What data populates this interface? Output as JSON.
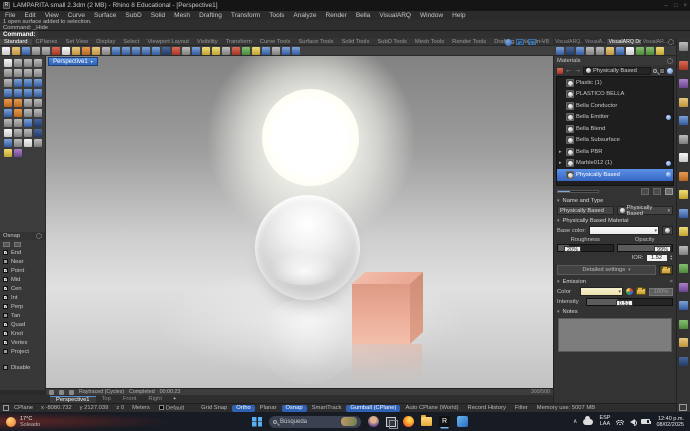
{
  "window": {
    "title": "LAMPARITA small 2.3dm (2 MB) - Rhino 8 Educational - [Perspective1]",
    "controls": {
      "minimize": "–",
      "maximize": "□",
      "close": "×"
    }
  },
  "menu": [
    {
      "label": "File"
    },
    {
      "label": "Edit"
    },
    {
      "label": "View"
    },
    {
      "label": "Curve"
    },
    {
      "label": "Surface"
    },
    {
      "label": "SubD"
    },
    {
      "label": "Solid"
    },
    {
      "label": "Mesh"
    },
    {
      "label": "Drafting"
    },
    {
      "label": "Transform"
    },
    {
      "label": "Tools"
    },
    {
      "label": "Analyze"
    },
    {
      "label": "Render"
    },
    {
      "label": "Bella"
    },
    {
      "label": "VisualARQ"
    },
    {
      "label": "Window"
    },
    {
      "label": "Help"
    }
  ],
  "command": {
    "history_line1": "1 open surface added to selection.",
    "history_line2": "Command: _Hide",
    "prompt": "Command:"
  },
  "toolbar_tabs": [
    {
      "label": "Standard",
      "state": "active"
    },
    {
      "label": "CPlanes"
    },
    {
      "label": "Set View"
    },
    {
      "label": "Display"
    },
    {
      "label": "Select"
    },
    {
      "label": "Viewport Layout"
    },
    {
      "label": "Visibility"
    },
    {
      "label": "Transform"
    },
    {
      "label": "Curve Tools"
    },
    {
      "label": "Surface Tools"
    },
    {
      "label": "Solid Tools"
    },
    {
      "label": "SubD Tools"
    },
    {
      "label": "Mesh Tools"
    },
    {
      "label": "Render Tools"
    },
    {
      "label": "Drafting"
    },
    {
      "label": "New in V8"
    }
  ],
  "quick_icons": [
    {
      "n": "render-sphere-icon"
    },
    {
      "n": "ipr-start-icon"
    },
    {
      "n": "ipr-window-icon"
    }
  ],
  "main_icons": [
    {
      "n": "new-file-icon",
      "c": "i0"
    },
    {
      "n": "open-file-icon",
      "c": "i1"
    },
    {
      "n": "save-icon",
      "c": "i2"
    },
    {
      "n": "print-icon",
      "c": "i9"
    },
    {
      "n": "cut-icon",
      "c": "i9"
    },
    {
      "n": "delete-icon",
      "c": "i5"
    },
    {
      "n": "copy-icon",
      "c": "i0"
    },
    {
      "n": "paste-icon",
      "c": "i1"
    },
    {
      "n": "undo-icon",
      "c": "i4"
    },
    {
      "n": "pan-icon",
      "c": "i1"
    },
    {
      "n": "move-view-icon",
      "c": "i9"
    },
    {
      "n": "zoom-icon",
      "c": "i2"
    },
    {
      "n": "zoom-window-icon",
      "c": "i2"
    },
    {
      "n": "zoom-extents-icon",
      "c": "i2"
    },
    {
      "n": "zoom-selected-icon",
      "c": "i2"
    },
    {
      "n": "rotate-view-icon",
      "c": "i2"
    },
    {
      "n": "layers-icon",
      "c": "i3"
    },
    {
      "n": "hide-icon",
      "c": "i5"
    },
    {
      "n": "show-icon",
      "c": "i9"
    },
    {
      "n": "select-icon",
      "c": "i2"
    },
    {
      "n": "lasso-icon",
      "c": "i7"
    },
    {
      "n": "light-icon",
      "c": "i7"
    },
    {
      "n": "move-icon",
      "c": "i9"
    },
    {
      "n": "render-icon",
      "c": "i5"
    },
    {
      "n": "render-preview-icon",
      "c": "i6"
    },
    {
      "n": "sun-icon",
      "c": "i7"
    },
    {
      "n": "material-icon",
      "c": "i2"
    },
    {
      "n": "options-icon",
      "c": "i9"
    },
    {
      "n": "gumball-icon",
      "c": "i2"
    },
    {
      "n": "help-icon",
      "c": "i2"
    }
  ],
  "panel_tabs": [
    {
      "label": "VisualARQ.."
    },
    {
      "label": "VisualA..."
    },
    {
      "label": "VisualARQ Doc...",
      "state": "active"
    },
    {
      "label": "VisualAR..."
    }
  ],
  "va_icons": [
    {
      "n": "va-select-icon",
      "c": "i2"
    },
    {
      "n": "va-orbit-icon",
      "c": "i3"
    },
    {
      "n": "va-wall-icon",
      "c": "i2"
    },
    {
      "n": "va-dots-icon",
      "c": "i9"
    },
    {
      "n": "va-beam-icon",
      "c": "i9"
    },
    {
      "n": "va-door-icon",
      "c": "i1"
    },
    {
      "n": "va-window-icon",
      "c": "i2"
    },
    {
      "n": "va-house-icon",
      "c": "i0"
    },
    {
      "n": "va-globe-icon",
      "c": "i6"
    },
    {
      "n": "va-globe2-icon",
      "c": "i6"
    },
    {
      "n": "va-table-icon",
      "c": "i7"
    }
  ],
  "left_icons": [
    {
      "n": "pointer-tool-icon",
      "c": "i0"
    },
    {
      "n": "select-tool-icon",
      "c": "i9"
    },
    {
      "n": "line-tool-icon",
      "c": "i9"
    },
    {
      "n": "curve-tool-icon",
      "c": "i9"
    },
    {
      "n": "point-tool-icon",
      "c": "i9"
    },
    {
      "n": "circle-tool-icon",
      "c": "i9"
    },
    {
      "n": "arc-tool-icon",
      "c": "i9"
    },
    {
      "n": "rectangle-tool-icon",
      "c": "i9"
    },
    {
      "n": "polygon-tool-icon",
      "c": "i9"
    },
    {
      "n": "surface-tool-icon",
      "c": "i2"
    },
    {
      "n": "loft-tool-icon",
      "c": "i2"
    },
    {
      "n": "sweep-tool-icon",
      "c": "i2"
    },
    {
      "n": "box-tool-icon",
      "c": "i2"
    },
    {
      "n": "sphere-tool-icon",
      "c": "i2"
    },
    {
      "n": "cylinder-tool-icon",
      "c": "i2"
    },
    {
      "n": "pipe-tool-icon",
      "c": "i2"
    },
    {
      "n": "fillet-tool-icon",
      "c": "i4"
    },
    {
      "n": "chamfer-tool-icon",
      "c": "i4"
    },
    {
      "n": "trim-tool-icon",
      "c": "i9"
    },
    {
      "n": "split-tool-icon",
      "c": "i9"
    },
    {
      "n": "join-tool-icon",
      "c": "i2"
    },
    {
      "n": "explode-tool-icon",
      "c": "i4"
    },
    {
      "n": "move-tool-icon",
      "c": "i9"
    },
    {
      "n": "copy-tool-icon",
      "c": "i9"
    },
    {
      "n": "rotate-tool-icon",
      "c": "i9"
    },
    {
      "n": "scale-tool-icon",
      "c": "i9"
    },
    {
      "n": "mirror-tool-icon",
      "c": "i2"
    },
    {
      "n": "array-tool-icon",
      "c": "i3"
    },
    {
      "n": "text-tool-icon",
      "c": "i0"
    },
    {
      "n": "dimension-tool-icon",
      "c": "i9"
    },
    {
      "n": "leader-tool-icon",
      "c": "i9"
    },
    {
      "n": "hatch-tool-icon",
      "c": "i3"
    },
    {
      "n": "block-tool-icon",
      "c": "i2"
    },
    {
      "n": "group-tool-icon",
      "c": "i9"
    },
    {
      "n": "check-tool-icon",
      "c": "i0"
    },
    {
      "n": "measure-tool-icon",
      "c": "i9"
    },
    {
      "n": "lamp-tool-icon",
      "c": "i7"
    },
    {
      "n": "material-tool-icon",
      "c": "i8"
    }
  ],
  "osnap": {
    "title": "Osnap",
    "items": [
      {
        "label": "End",
        "state": "on"
      },
      {
        "label": "Near",
        "state": "off"
      },
      {
        "label": "Point",
        "state": "on"
      },
      {
        "label": "Mid",
        "state": "on"
      },
      {
        "label": "Cen",
        "state": "on"
      },
      {
        "label": "Int",
        "state": "on"
      },
      {
        "label": "Perp",
        "state": "on"
      },
      {
        "label": "Tan",
        "state": "off"
      },
      {
        "label": "Quad",
        "state": "on"
      },
      {
        "label": "Knot",
        "state": "on"
      },
      {
        "label": "Vertex",
        "state": "on"
      },
      {
        "label": "Project",
        "state": "off"
      }
    ],
    "disable_label": "Disable"
  },
  "viewport": {
    "active_view": "Perspective1",
    "render_mode": "Raytraced (Cycles)",
    "render_status": "Completed",
    "render_time": "00:00:23",
    "render_samples": "300/500"
  },
  "viewport_tabs": {
    "tabs": [
      {
        "label": "Perspective1",
        "state": "active"
      },
      {
        "label": "Top"
      },
      {
        "label": "Front"
      },
      {
        "label": "Right"
      }
    ],
    "new_tab": "+"
  },
  "status": {
    "left": [
      {
        "label": "CPlane"
      },
      {
        "label": "x -8080.732"
      },
      {
        "label": "y 2127.039"
      },
      {
        "label": "z 0"
      },
      {
        "label": "Meters"
      }
    ],
    "layer_label": "Default",
    "toggles": [
      {
        "label": "Grid Snap"
      },
      {
        "label": "Ortho",
        "state": "active"
      },
      {
        "label": "Planar"
      },
      {
        "label": "Osnap",
        "state": "active"
      },
      {
        "label": "SmartTrack"
      },
      {
        "label": "Gumball (CPlane)",
        "state": "active"
      },
      {
        "label": "Auto CPlane (World)"
      },
      {
        "label": "Record History"
      },
      {
        "label": "Filter"
      }
    ],
    "memory": "Memory use: 5007 MB"
  },
  "materials": {
    "panel_title": "Materials",
    "search_value": "Physically Based",
    "list": [
      {
        "name": "Plastic (1)"
      },
      {
        "name": "PLASTICO BELLA"
      },
      {
        "name": "Bella Conductor"
      },
      {
        "name": "Bella Emitter",
        "dot": "show"
      },
      {
        "name": "Bella Blend"
      },
      {
        "name": "Bella Subsurface"
      },
      {
        "name": "Bella PBR",
        "exp": "show"
      },
      {
        "name": "Marble012 (1)",
        "exp": "show",
        "dot": "show"
      },
      {
        "name": "Physically Based",
        "state": "selected",
        "dot": "show"
      }
    ],
    "name_type": {
      "section": "Name and Type",
      "name_value": "Physically Based",
      "type_value": "Physically Based"
    },
    "pbm": {
      "section": "Physically Based Material",
      "base_color_label": "Base color:",
      "roughness_label": "Roughness",
      "roughness_value": "20%",
      "opacity_label": "Opacity",
      "opacity_value": "99%",
      "ior_label": "IOR:",
      "ior_value": "1.52",
      "detailed_settings_label": "Detailed settings"
    },
    "emission": {
      "section": "Emission",
      "color_label": "Color",
      "strength_value": "100%",
      "intensity_label": "Intensity",
      "intensity_value": "0.51"
    },
    "notes_section": "Notes"
  },
  "strip_icons": [
    {
      "n": "panel-gear-icon",
      "c": "i9"
    },
    {
      "n": "brush-icon",
      "c": "i5"
    },
    {
      "n": "color-wheel-icon",
      "c": "i8"
    },
    {
      "n": "mail-icon",
      "c": "i1"
    },
    {
      "n": "layers-panel-icon",
      "c": "i2"
    },
    {
      "n": "grid-panel-icon",
      "c": "i9"
    },
    {
      "n": "text-panel-icon",
      "c": "i0"
    },
    {
      "n": "stamp-icon",
      "c": "i4"
    },
    {
      "n": "pen-icon",
      "c": "i7"
    },
    {
      "n": "book-icon",
      "c": "i2"
    },
    {
      "n": "bulb-icon",
      "c": "i7"
    },
    {
      "n": "wrench-icon",
      "c": "i9"
    },
    {
      "n": "add-icon",
      "c": "i6"
    },
    {
      "n": "palette-icon",
      "c": "i8"
    },
    {
      "n": "cube-panel-icon",
      "c": "i2"
    },
    {
      "n": "leaf-icon",
      "c": "i6"
    },
    {
      "n": "map-icon",
      "c": "i1"
    },
    {
      "n": "blue-panel-icon",
      "c": "i3"
    }
  ],
  "taskbar": {
    "weather": {
      "temp": "17°C",
      "condition": "Soleado"
    },
    "search_value": "Búsqueda",
    "app_icons": [
      "start-icon",
      "search-avatar-icon",
      "task-view-icon",
      "firefox-icon",
      "file-explorer-icon",
      "rhino-app-icon",
      "blue-app-icon"
    ],
    "tray": {
      "lang_top": "ESP",
      "lang_bottom": "LAA",
      "time": "12:40 p.m.",
      "date": "08/02/2025"
    }
  }
}
